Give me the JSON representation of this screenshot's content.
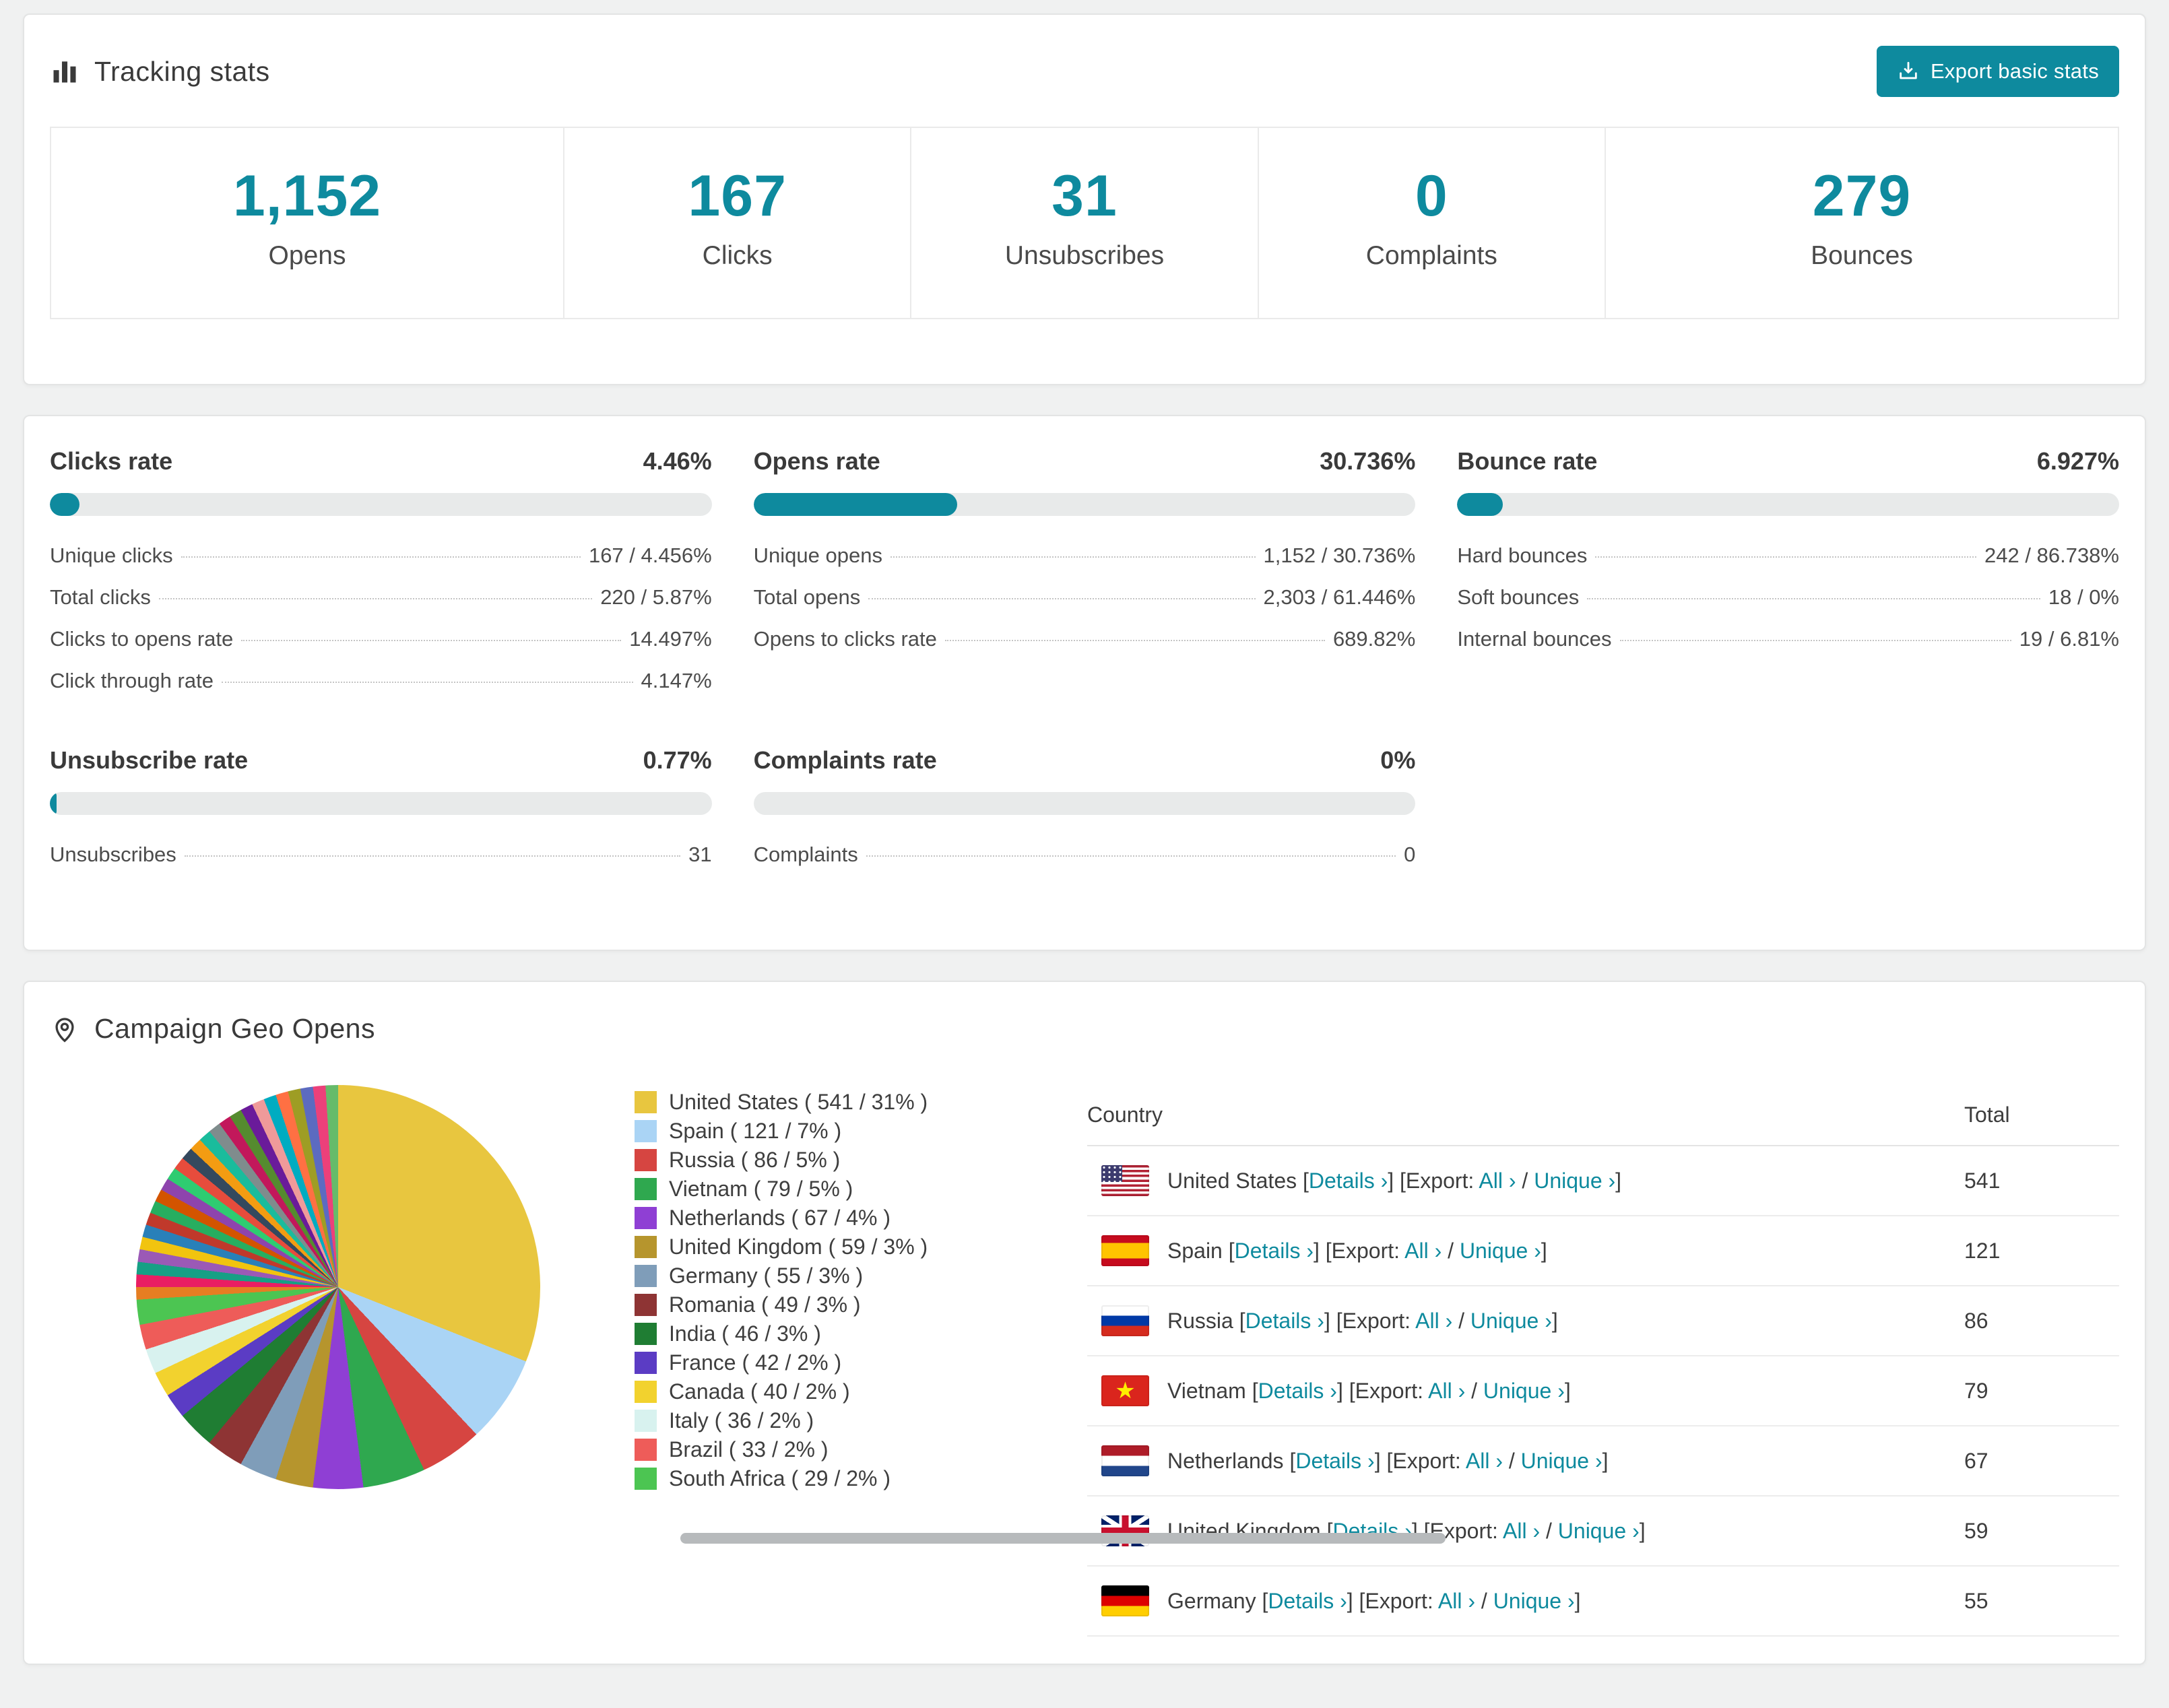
{
  "theme": {
    "accent": "#0e8a9e",
    "page_bg": "#f0f1f1",
    "progress_track": "#e8eaea",
    "scrollbar": "#b7babc"
  },
  "tracking": {
    "title": "Tracking stats",
    "export_button": "Export basic stats",
    "summary": [
      {
        "value": "1,152",
        "label": "Opens"
      },
      {
        "value": "167",
        "label": "Clicks"
      },
      {
        "value": "31",
        "label": "Unsubscribes"
      },
      {
        "value": "0",
        "label": "Complaints"
      },
      {
        "value": "279",
        "label": "Bounces"
      }
    ]
  },
  "rates": [
    {
      "title": "Clicks rate",
      "value": "4.46%",
      "pct": 4.46,
      "rows": [
        {
          "label": "Unique clicks",
          "value": "167 / 4.456%"
        },
        {
          "label": "Total clicks",
          "value": "220 / 5.87%"
        },
        {
          "label": "Clicks to opens rate",
          "value": "14.497%"
        },
        {
          "label": "Click through rate",
          "value": "4.147%"
        }
      ]
    },
    {
      "title": "Opens rate",
      "value": "30.736%",
      "pct": 30.736,
      "rows": [
        {
          "label": "Unique opens",
          "value": "1,152 / 30.736%"
        },
        {
          "label": "Total opens",
          "value": "2,303 / 61.446%"
        },
        {
          "label": "Opens to clicks rate",
          "value": "689.82%"
        }
      ]
    },
    {
      "title": "Bounce rate",
      "value": "6.927%",
      "pct": 6.927,
      "rows": [
        {
          "label": "Hard bounces",
          "value": "242 / 86.738%"
        },
        {
          "label": "Soft bounces",
          "value": "18 / 0%"
        },
        {
          "label": "Internal bounces",
          "value": "19 / 6.81%"
        }
      ]
    },
    {
      "title": "Unsubscribe rate",
      "value": "0.77%",
      "pct": 0.77,
      "rows": [
        {
          "label": "Unsubscribes",
          "value": "31"
        }
      ]
    },
    {
      "title": "Complaints rate",
      "value": "0%",
      "pct": 0,
      "rows": [
        {
          "label": "Complaints",
          "value": "0"
        }
      ]
    }
  ],
  "geo": {
    "title": "Campaign Geo Opens",
    "table": {
      "columns": [
        "Country",
        "Total"
      ],
      "details_label": "Details ›",
      "export_label": "Export:",
      "all_label": "All ›",
      "unique_label": "Unique ›",
      "bracket_open": "[",
      "bracket_close": "]",
      "slash": "/",
      "rows": [
        {
          "country": "United States",
          "flag": "us",
          "total": "541"
        },
        {
          "country": "Spain",
          "flag": "es",
          "total": "121"
        },
        {
          "country": "Russia",
          "flag": "ru",
          "total": "86"
        },
        {
          "country": "Vietnam",
          "flag": "vn",
          "total": "79"
        },
        {
          "country": "Netherlands",
          "flag": "nl",
          "total": "67"
        },
        {
          "country": "United Kingdom",
          "flag": "gb",
          "total": "59"
        },
        {
          "country": "Germany",
          "flag": "de",
          "total": "55"
        }
      ]
    }
  },
  "chart_data": {
    "type": "pie",
    "title": "Campaign Geo Opens",
    "value_unit": "opens",
    "legend_position": "right",
    "legend_format": "{label} ( {value} / {pct}% )",
    "slices": [
      {
        "label": "United States",
        "value": 541,
        "pct": 31,
        "color": "#e8c63f"
      },
      {
        "label": "Spain",
        "value": 121,
        "pct": 7,
        "color": "#aad4f5"
      },
      {
        "label": "Russia",
        "value": 86,
        "pct": 5,
        "color": "#d64541"
      },
      {
        "label": "Vietnam",
        "value": 79,
        "pct": 5,
        "color": "#2fa84f"
      },
      {
        "label": "Netherlands",
        "value": 67,
        "pct": 4,
        "color": "#8f3fd4"
      },
      {
        "label": "United Kingdom",
        "value": 59,
        "pct": 3,
        "color": "#b6952d"
      },
      {
        "label": "Germany",
        "value": 55,
        "pct": 3,
        "color": "#7f9db9"
      },
      {
        "label": "Romania",
        "value": 49,
        "pct": 3,
        "color": "#8e3434"
      },
      {
        "label": "India",
        "value": 46,
        "pct": 3,
        "color": "#1f7d33"
      },
      {
        "label": "France",
        "value": 42,
        "pct": 2,
        "color": "#5b3cc4"
      },
      {
        "label": "Canada",
        "value": 40,
        "pct": 2,
        "color": "#f2d22e"
      },
      {
        "label": "Italy",
        "value": 36,
        "pct": 2,
        "color": "#d8f2ef"
      },
      {
        "label": "Brazil",
        "value": 33,
        "pct": 2,
        "color": "#ee5c59"
      },
      {
        "label": "South Africa",
        "value": 29,
        "pct": 2,
        "color": "#4cc552"
      }
    ],
    "others": {
      "pct": 26,
      "colors": [
        "#e67e22",
        "#e91e63",
        "#16a085",
        "#9b59b6",
        "#f1c40f",
        "#2980b9",
        "#c0392b",
        "#27ae60",
        "#d35400",
        "#8e44ad",
        "#2ecc71",
        "#e74c3c",
        "#34495e",
        "#f39c12",
        "#1abc9c",
        "#7f8c8d",
        "#c2185b",
        "#558b2f",
        "#6a1b9a",
        "#ef9a9a",
        "#00acc1",
        "#ff7043",
        "#9e9d24",
        "#5c6bc0",
        "#ec407a",
        "#66bb6a"
      ]
    }
  }
}
